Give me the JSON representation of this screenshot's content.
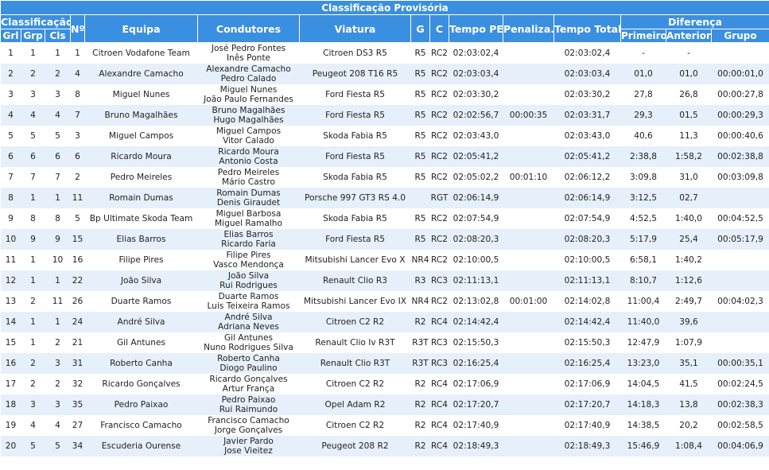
{
  "table": {
    "title": "Classificação Provisória",
    "headers": {
      "classificacao": "Classificação",
      "grl": "Grl",
      "grp": "Grp",
      "cls": "Cls",
      "num": "Nº",
      "equipa": "Equipa",
      "condutores": "Condutores",
      "viatura": "Viatura",
      "g": "G",
      "c": "C",
      "tempo_pe": "Tempo PE",
      "penaliza": "Penaliza.",
      "tempo_total": "Tempo Total",
      "diferenca": "Diferença",
      "primeiro": "Primeiro",
      "anterior": "Anterior",
      "grupo": "Grupo"
    },
    "rows": [
      {
        "grl": "1",
        "grp": "1",
        "cls": "1",
        "num": "1",
        "team": "Citroen Vodafone Team",
        "driver1": "José Pedro Fontes",
        "driver2": "Inês Ponte",
        "car": "Citroen DS3 R5",
        "g": "R5",
        "c": "RC2",
        "tempo_pe": "02:03:02,4",
        "pen": "",
        "total": "02:03:02,4",
        "primeiro": "-",
        "anterior": "-",
        "grupo": ""
      },
      {
        "grl": "2",
        "grp": "2",
        "cls": "2",
        "num": "4",
        "team": "Alexandre Camacho",
        "driver1": "Alexandre Camacho",
        "driver2": "Pedro Calado",
        "car": "Peugeot 208 T16 R5",
        "g": "R5",
        "c": "RC2",
        "tempo_pe": "02:03:03,4",
        "pen": "",
        "total": "02:03:03,4",
        "primeiro": "01,0",
        "anterior": "01,0",
        "grupo": "00:00:01,0"
      },
      {
        "grl": "3",
        "grp": "3",
        "cls": "3",
        "num": "8",
        "team": "Miguel Nunes",
        "driver1": "Miguel Nunes",
        "driver2": "João Paulo Fernandes",
        "car": "Ford Fiesta R5",
        "g": "R5",
        "c": "RC2",
        "tempo_pe": "02:03:30,2",
        "pen": "",
        "total": "02:03:30,2",
        "primeiro": "27,8",
        "anterior": "26,8",
        "grupo": "00:00:27,8"
      },
      {
        "grl": "4",
        "grp": "4",
        "cls": "4",
        "num": "7",
        "team": "Bruno Magalhães",
        "driver1": "Bruno Magalhães",
        "driver2": "Hugo Magalhães",
        "car": "Ford Fiesta R5",
        "g": "R5",
        "c": "RC2",
        "tempo_pe": "02:02:56,7",
        "pen": "00:00:35",
        "total": "02:03:31,7",
        "primeiro": "29,3",
        "anterior": "01,5",
        "grupo": "00:00:29,3"
      },
      {
        "grl": "5",
        "grp": "5",
        "cls": "5",
        "num": "3",
        "team": "Miguel Campos",
        "driver1": "Miguel Campos",
        "driver2": "Vitor Calado",
        "car": "Skoda Fabia R5",
        "g": "R5",
        "c": "RC2",
        "tempo_pe": "02:03:43,0",
        "pen": "",
        "total": "02:03:43,0",
        "primeiro": "40,6",
        "anterior": "11,3",
        "grupo": "00:00:40,6"
      },
      {
        "grl": "6",
        "grp": "6",
        "cls": "6",
        "num": "6",
        "team": "Ricardo Moura",
        "driver1": "Ricardo Moura",
        "driver2": "Antonio Costa",
        "car": "Ford Fiesta R5",
        "g": "R5",
        "c": "RC2",
        "tempo_pe": "02:05:41,2",
        "pen": "",
        "total": "02:05:41,2",
        "primeiro": "2:38,8",
        "anterior": "1:58,2",
        "grupo": "00:02:38,8"
      },
      {
        "grl": "7",
        "grp": "7",
        "cls": "7",
        "num": "2",
        "team": "Pedro Meireles",
        "driver1": "Pedro Meireles",
        "driver2": "Mário Castro",
        "car": "Skoda Fabia R5",
        "g": "R5",
        "c": "RC2",
        "tempo_pe": "02:05:02,2",
        "pen": "00:01:10",
        "total": "02:06:12,2",
        "primeiro": "3:09,8",
        "anterior": "31,0",
        "grupo": "00:03:09,8"
      },
      {
        "grl": "8",
        "grp": "1",
        "cls": "1",
        "num": "11",
        "team": "Romain Dumas",
        "driver1": "Romain Dumas",
        "driver2": "Denis Giraudet",
        "car": "Porsche 997 GT3 RS 4.0",
        "g": "",
        "c": "RGT",
        "tempo_pe": "02:06:14,9",
        "pen": "",
        "total": "02:06:14,9",
        "primeiro": "3:12,5",
        "anterior": "02,7",
        "grupo": ""
      },
      {
        "grl": "9",
        "grp": "8",
        "cls": "8",
        "num": "5",
        "team": "Bp Ultimate Skoda Team",
        "driver1": "Miguel Barbosa",
        "driver2": "Miguel Ramalho",
        "car": "Skoda Fabia R5",
        "g": "R5",
        "c": "RC2",
        "tempo_pe": "02:07:54,9",
        "pen": "",
        "total": "02:07:54,9",
        "primeiro": "4:52,5",
        "anterior": "1:40,0",
        "grupo": "00:04:52,5"
      },
      {
        "grl": "10",
        "grp": "9",
        "cls": "9",
        "num": "15",
        "team": "Elias Barros",
        "driver1": "Elias Barros",
        "driver2": "Ricardo Faria",
        "car": "Ford Fiesta R5",
        "g": "R5",
        "c": "RC2",
        "tempo_pe": "02:08:20,3",
        "pen": "",
        "total": "02:08:20,3",
        "primeiro": "5:17,9",
        "anterior": "25,4",
        "grupo": "00:05:17,9"
      },
      {
        "grl": "11",
        "grp": "1",
        "cls": "10",
        "num": "16",
        "team": "Filipe Pires",
        "driver1": "Filipe Pires",
        "driver2": "Vasco Mendonça",
        "car": "Mitsubishi Lancer Evo X",
        "g": "NR4",
        "c": "RC2",
        "tempo_pe": "02:10:00,5",
        "pen": "",
        "total": "02:10:00,5",
        "primeiro": "6:58,1",
        "anterior": "1:40,2",
        "grupo": ""
      },
      {
        "grl": "12",
        "grp": "1",
        "cls": "1",
        "num": "22",
        "team": "João Silva",
        "driver1": "João Silva",
        "driver2": "Rui Rodrigues",
        "car": "Renault Clio R3",
        "g": "R3",
        "c": "RC3",
        "tempo_pe": "02:11:13,1",
        "pen": "",
        "total": "02:11:13,1",
        "primeiro": "8:10,7",
        "anterior": "1:12,6",
        "grupo": ""
      },
      {
        "grl": "13",
        "grp": "2",
        "cls": "11",
        "num": "26",
        "team": "Duarte Ramos",
        "driver1": "Duarte Ramos",
        "driver2": "Luis Teixeira Ramos",
        "car": "Mitsubishi Lancer Evo IX",
        "g": "NR4",
        "c": "RC2",
        "tempo_pe": "02:13:02,8",
        "pen": "00:01:00",
        "total": "02:14:02,8",
        "primeiro": "11:00,4",
        "anterior": "2:49,7",
        "grupo": "00:04:02,3"
      },
      {
        "grl": "14",
        "grp": "1",
        "cls": "1",
        "num": "24",
        "team": "André Silva",
        "driver1": "André Silva",
        "driver2": "Adriana Neves",
        "car": "Citroen C2 R2",
        "g": "R2",
        "c": "RC4",
        "tempo_pe": "02:14:42,4",
        "pen": "",
        "total": "02:14:42,4",
        "primeiro": "11:40,0",
        "anterior": "39,6",
        "grupo": ""
      },
      {
        "grl": "15",
        "grp": "1",
        "cls": "2",
        "num": "21",
        "team": "Gil Antunes",
        "driver1": "Gil Antunes",
        "driver2": "Nuno Rodrigues Silva",
        "car": "Renault Clio Iv R3T",
        "g": "R3T",
        "c": "RC3",
        "tempo_pe": "02:15:50,3",
        "pen": "",
        "total": "02:15:50,3",
        "primeiro": "12:47,9",
        "anterior": "1:07,9",
        "grupo": ""
      },
      {
        "grl": "16",
        "grp": "2",
        "cls": "3",
        "num": "31",
        "team": "Roberto Canha",
        "driver1": "Roberto Canha",
        "driver2": "Diogo Paulino",
        "car": "Renault Clio R3T",
        "g": "R3T",
        "c": "RC3",
        "tempo_pe": "02:16:25,4",
        "pen": "",
        "total": "02:16:25,4",
        "primeiro": "13:23,0",
        "anterior": "35,1",
        "grupo": "00:00:35,1"
      },
      {
        "grl": "17",
        "grp": "2",
        "cls": "2",
        "num": "32",
        "team": "Ricardo Gonçalves",
        "driver1": "Ricardo Gonçalves",
        "driver2": "Artur França",
        "car": "Citroen C2 R2",
        "g": "R2",
        "c": "RC4",
        "tempo_pe": "02:17:06,9",
        "pen": "",
        "total": "02:17:06,9",
        "primeiro": "14:04,5",
        "anterior": "41,5",
        "grupo": "00:02:24,5"
      },
      {
        "grl": "18",
        "grp": "3",
        "cls": "3",
        "num": "35",
        "team": "Pedro Paixao",
        "driver1": "Pedro Paixao",
        "driver2": "Rui Raimundo",
        "car": "Opel Adam R2",
        "g": "R2",
        "c": "RC4",
        "tempo_pe": "02:17:20,7",
        "pen": "",
        "total": "02:17:20,7",
        "primeiro": "14:18,3",
        "anterior": "13,8",
        "grupo": "00:02:38,3"
      },
      {
        "grl": "19",
        "grp": "4",
        "cls": "4",
        "num": "27",
        "team": "Francisco Camacho",
        "driver1": "Francisco Camacho",
        "driver2": "Jorge Gonçalves",
        "car": "Citroen C2 R2",
        "g": "R2",
        "c": "RC4",
        "tempo_pe": "02:17:40,9",
        "pen": "",
        "total": "02:17:40,9",
        "primeiro": "14:38,5",
        "anterior": "20,2",
        "grupo": "00:02:58,5"
      },
      {
        "grl": "20",
        "grp": "5",
        "cls": "5",
        "num": "34",
        "team": "Escuderia Ourense",
        "driver1": "Javier Pardo",
        "driver2": "Jose Vieitez",
        "car": "Peugeot 208 R2",
        "g": "R2",
        "c": "RC4",
        "tempo_pe": "02:18:49,3",
        "pen": "",
        "total": "02:18:49,3",
        "primeiro": "15:46,9",
        "anterior": "1:08,4",
        "grupo": "00:04:06,9"
      }
    ]
  }
}
